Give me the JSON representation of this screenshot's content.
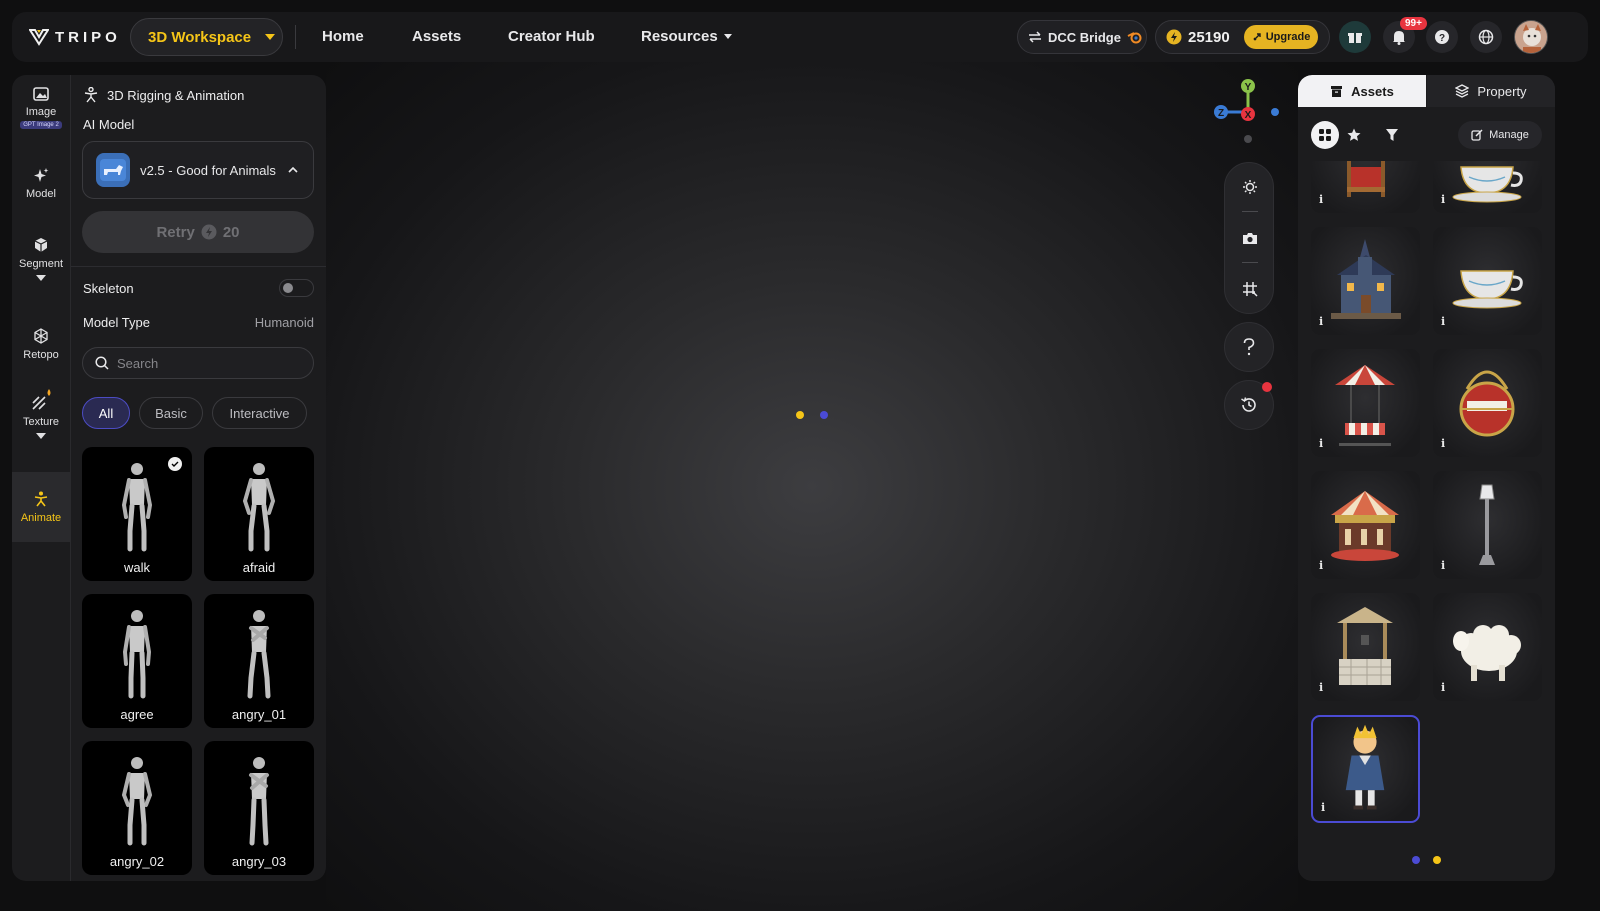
{
  "header": {
    "logo_text": "TRIPO",
    "workspace_label": "3D Workspace",
    "nav": [
      "Home",
      "Assets",
      "Creator Hub",
      "Resources"
    ],
    "dcc_label": "DCC Bridge",
    "credits": "25190",
    "upgrade_label": "Upgrade",
    "notifications_badge": "99+"
  },
  "rail": {
    "items": [
      {
        "label": "Image",
        "badge": "GPT Image 2"
      },
      {
        "label": "Model"
      },
      {
        "label": "Segment"
      },
      {
        "label": "Retopo"
      },
      {
        "label": "Texture"
      },
      {
        "label": "Animate"
      }
    ]
  },
  "panel": {
    "title": "3D Rigging & Animation",
    "ai_model_label": "AI Model",
    "model_name": "v2.5 - Good for Animals",
    "retry_label": "Retry",
    "retry_cost": "20",
    "skeleton_label": "Skeleton",
    "model_type_label": "Model Type",
    "model_type_value": "Humanoid",
    "search_placeholder": "Search",
    "filters": [
      "All",
      "Basic",
      "Interactive"
    ],
    "animations": [
      "walk",
      "afraid",
      "agree",
      "angry_01",
      "angry_02",
      "angry_03"
    ]
  },
  "axis": {
    "y": "Y",
    "z": "Z",
    "x": "X"
  },
  "right": {
    "tab_assets": "Assets",
    "tab_property": "Property",
    "manage_label": "Manage",
    "info_glyph": "i"
  },
  "colors": {
    "accent_yellow": "#f5c518",
    "accent_blue": "#4b4bd4",
    "badge_red": "#e8343f"
  }
}
